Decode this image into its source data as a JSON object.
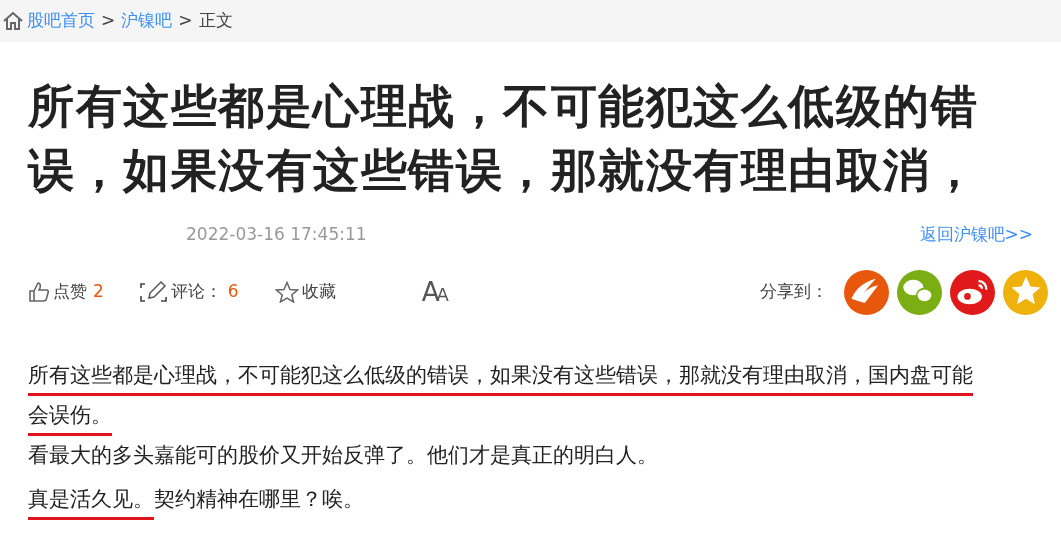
{
  "breadcrumb": [
    {
      "label": "股吧首页",
      "kind": "link"
    },
    {
      "label": "沪镍吧",
      "kind": "link"
    },
    {
      "label": "正文",
      "kind": "current"
    }
  ],
  "breadcrumb_separator": ">",
  "title": "所有这些都是心理战，不可能犯这么低级的错误，如果没有这些错误，那就没有理由取消，",
  "post_time": "2022-03-16 17:45:11",
  "back_link": "返回沪镍吧>>",
  "actions": [
    {
      "kind": "like",
      "label": "点赞",
      "count": "2"
    },
    {
      "kind": "comment",
      "label": "评论：",
      "count": "6"
    },
    {
      "kind": "favorite",
      "label": "收藏"
    },
    {
      "kind": "font",
      "label": "AA"
    }
  ],
  "share_label": "分享到：",
  "share_targets": [
    {
      "kind": "feed",
      "color": "#e8580c"
    },
    {
      "kind": "chat",
      "color": "#7aae12"
    },
    {
      "kind": "weibo",
      "color": "#e01a1a"
    },
    {
      "kind": "star",
      "color": "#efb10b"
    }
  ],
  "paragraphs": [
    {
      "segments": [
        {
          "text": "所有这些都是心理战，不可能犯这么低级的错误，如果没有这些错误，那就没有理由取消，国内盘可能会误伤。",
          "underlined": true
        }
      ]
    },
    {
      "segments": [
        {
          "text": "看最大的多头嘉能可的股价又开始反弹了。他们才是真正的明白人。",
          "underlined": false
        }
      ]
    },
    {
      "segments": [
        {
          "text": "真是活久见。",
          "underlined": true
        },
        {
          "text": "契约精神在哪里？唉。",
          "underlined": false
        }
      ]
    }
  ]
}
